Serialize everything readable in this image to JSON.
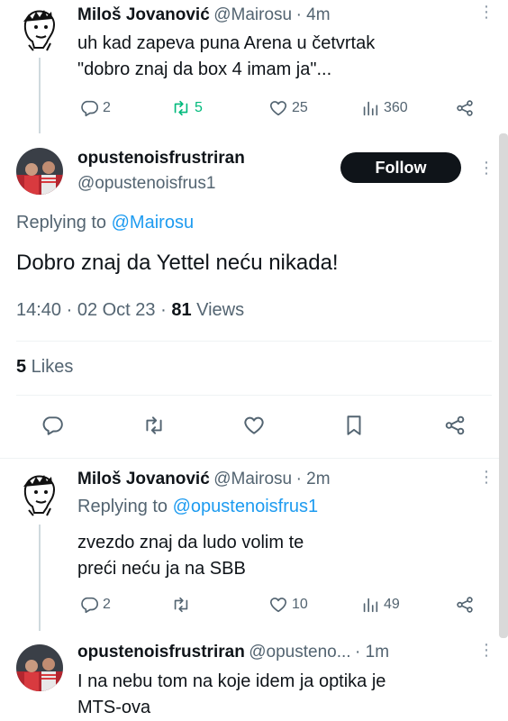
{
  "tweet1": {
    "name": "Miloš Jovanović",
    "handle": "@Mairosu",
    "time": "· 4m",
    "text_line1": "uh kad zapeva puna Arena u četvrtak",
    "text_line2": "\"dobro znaj da box 4 imam ja\"...",
    "replies": "2",
    "retweets": "5",
    "likes": "25",
    "views": "360"
  },
  "main": {
    "name": "opustenoisfrustriran",
    "handle": "@opustenoisfrus1",
    "follow_label": "Follow",
    "replying_prefix": "Replying to",
    "replying_to": "@Mairosu",
    "text": "Dobro znaj da Yettel neću nikada!",
    "timestamp": "14:40 · 02 Oct 23 · ",
    "views_count": "81",
    "views_label": " Views",
    "likes_count": "5",
    "likes_label": " Likes"
  },
  "tweet3": {
    "name": "Miloš Jovanović",
    "handle": "@Mairosu",
    "time": "· 2m",
    "replying_prefix": "Replying to",
    "replying_to": "@opustenoisfrus1",
    "text_line1": "zvezdo znaj da ludo volim te",
    "text_line2": "preći neću ja na SBB",
    "replies": "2",
    "likes": "10",
    "views": "49"
  },
  "tweet4": {
    "name": "opustenoisfrustriran",
    "handle": "@opusteno...",
    "time": "· 1m",
    "text_line1": "I na nebu tom na koje idem ja optika je",
    "text_line2": "MTS-ova"
  },
  "colors": {
    "accent": "#1d9bf0",
    "retweet_active": "#00ba7c",
    "muted": "#536471"
  },
  "icons": [
    "reply-icon",
    "retweet-icon",
    "like-icon",
    "views-icon",
    "share-icon",
    "bookmark-icon",
    "more-icon"
  ]
}
